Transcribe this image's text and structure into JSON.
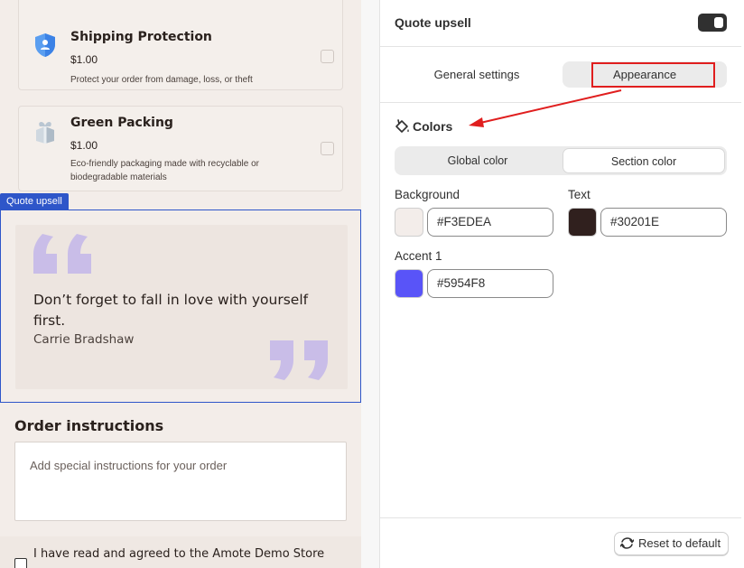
{
  "preview": {
    "addons": [
      {
        "title": "Shipping Protection",
        "price": "$1.00",
        "description": "Protect your order from damage, loss, or theft",
        "icon": "shield-icon"
      },
      {
        "title": "Green Packing",
        "price": "$1.00",
        "description": "Eco-friendly packaging made with recyclable or biodegradable materials",
        "icon": "gift-box-icon"
      }
    ],
    "section_tag": "Quote upsell",
    "quote": {
      "text": "Don’t forget to fall in love with yourself first.",
      "author": "Carrie Bradshaw",
      "mark_color": "#C9BDE8"
    },
    "order_instructions": {
      "title": "Order instructions",
      "placeholder": "Add special instructions for your order"
    },
    "terms_text": "I have read and agreed to the Amote Demo Store"
  },
  "panel": {
    "title": "Quote upsell",
    "toggle_on": true,
    "tabs": [
      {
        "label": "General settings",
        "active": false
      },
      {
        "label": "Appearance",
        "active": true
      }
    ],
    "colors_label": "Colors",
    "segment": [
      {
        "label": "Global color",
        "active": false
      },
      {
        "label": "Section color",
        "active": true
      }
    ],
    "fields": {
      "background": {
        "label": "Background",
        "value": "#F3EDEA"
      },
      "text": {
        "label": "Text",
        "value": "#30201E"
      },
      "accent1": {
        "label": "Accent 1",
        "value": "#5954F8"
      }
    },
    "reset_label": "Reset to default"
  },
  "annotation": {
    "highlight_color": "#E01E1E"
  }
}
